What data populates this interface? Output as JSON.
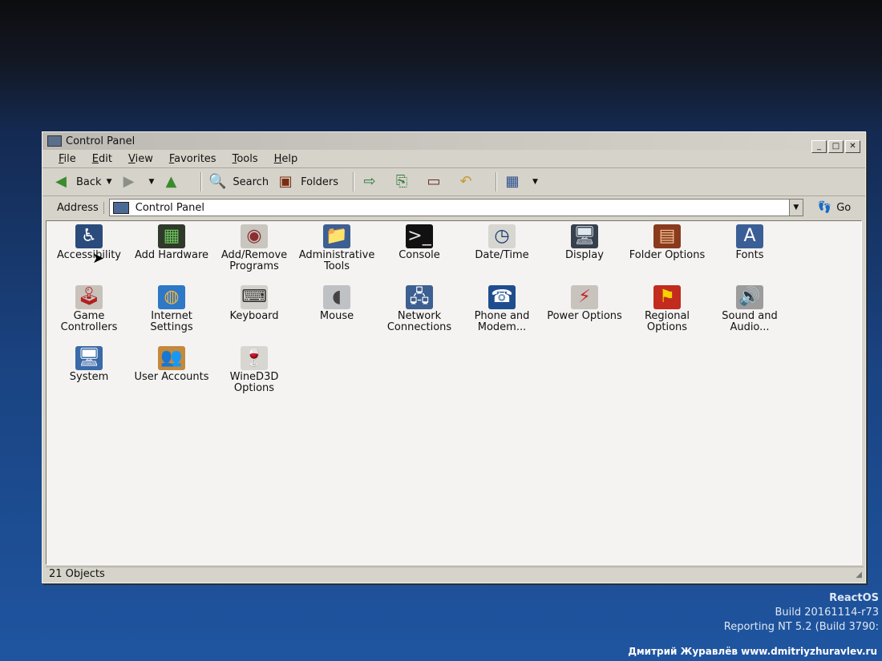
{
  "window": {
    "title": "Control Panel"
  },
  "menu": [
    "File",
    "Edit",
    "View",
    "Favorites",
    "Tools",
    "Help"
  ],
  "toolbar": {
    "back": "Back",
    "search": "Search",
    "folders": "Folders"
  },
  "address": {
    "label": "Address",
    "value": "Control Panel",
    "go": "Go"
  },
  "items": [
    {
      "label": "Accessibility",
      "icon": "accessibility-icon",
      "glyph": "♿",
      "bg": "#2a4b7c",
      "fg": "#ffffff"
    },
    {
      "label": "Add Hardware",
      "icon": "hardware-icon",
      "glyph": "▦",
      "bg": "#2f3a2b",
      "fg": "#6bc25a"
    },
    {
      "label": "Add/Remove Programs",
      "icon": "cd-install-icon",
      "glyph": "◉",
      "bg": "#c9c6c0",
      "fg": "#8a2f2f"
    },
    {
      "label": "Administrative Tools",
      "icon": "admin-tools-icon",
      "glyph": "📁",
      "bg": "#3d5f92",
      "fg": "#f0d050"
    },
    {
      "label": "Console",
      "icon": "console-icon",
      "glyph": ">_",
      "bg": "#111111",
      "fg": "#e0e0e0"
    },
    {
      "label": "Date/Time",
      "icon": "clock-icon",
      "glyph": "◷",
      "bg": "#d8d6d0",
      "fg": "#123a74"
    },
    {
      "label": "Display",
      "icon": "monitor-icon",
      "glyph": "🖥",
      "bg": "#37414d",
      "fg": "#dfe7ef"
    },
    {
      "label": "Folder Options",
      "icon": "folder-options-icon",
      "glyph": "▤",
      "bg": "#8a3a1d",
      "fg": "#f0c090"
    },
    {
      "label": "Fonts",
      "icon": "fonts-icon",
      "glyph": "A",
      "bg": "#3a5f96",
      "fg": "#ffffff"
    },
    {
      "label": "Game Controllers",
      "icon": "joystick-icon",
      "glyph": "🕹",
      "bg": "#c8c2bb",
      "fg": "#b21f1f"
    },
    {
      "label": "Internet Settings",
      "icon": "internet-icon",
      "glyph": "◍",
      "bg": "#2d78c7",
      "fg": "#f4b53f"
    },
    {
      "label": "Keyboard",
      "icon": "keyboard-icon",
      "glyph": "⌨",
      "bg": "#d2d0cb",
      "fg": "#333333"
    },
    {
      "label": "Mouse",
      "icon": "mouse-icon",
      "glyph": "◖",
      "bg": "#bfc1c4",
      "fg": "#444444"
    },
    {
      "label": "Network Connections",
      "icon": "network-icon",
      "glyph": "🖧",
      "bg": "#3d5f92",
      "fg": "#ffffff"
    },
    {
      "label": "Phone and Modem...",
      "icon": "phone-icon",
      "glyph": "☎",
      "bg": "#1f4e8f",
      "fg": "#ffffff"
    },
    {
      "label": "Power Options",
      "icon": "power-icon",
      "glyph": "⚡",
      "bg": "#c8c3bc",
      "fg": "#c0252a"
    },
    {
      "label": "Regional Options",
      "icon": "flags-icon",
      "glyph": "⚑",
      "bg": "#c22b1d",
      "fg": "#f6d200"
    },
    {
      "label": "Sound and Audio...",
      "icon": "speaker-icon",
      "glyph": "🔊",
      "bg": "#9c9c9c",
      "fg": "#222222"
    },
    {
      "label": "System",
      "icon": "system-icon",
      "glyph": "🖥",
      "bg": "#3a6aa8",
      "fg": "#ffffff"
    },
    {
      "label": "User Accounts",
      "icon": "users-icon",
      "glyph": "👥",
      "bg": "#c4893c",
      "fg": "#2b4f8c"
    },
    {
      "label": "WineD3D Options",
      "icon": "wine-icon",
      "glyph": "🍷",
      "bg": "#d8d6d0",
      "fg": "#9a1f2b"
    }
  ],
  "status": {
    "text": "21 Objects"
  },
  "brand": {
    "name": "ReactOS",
    "build": "Build 20161114-r73",
    "report": "Reporting NT 5.2 (Build 3790:"
  },
  "watermark": "Дмитрий Журавлёв www.dmitriyzhuravlev.ru"
}
